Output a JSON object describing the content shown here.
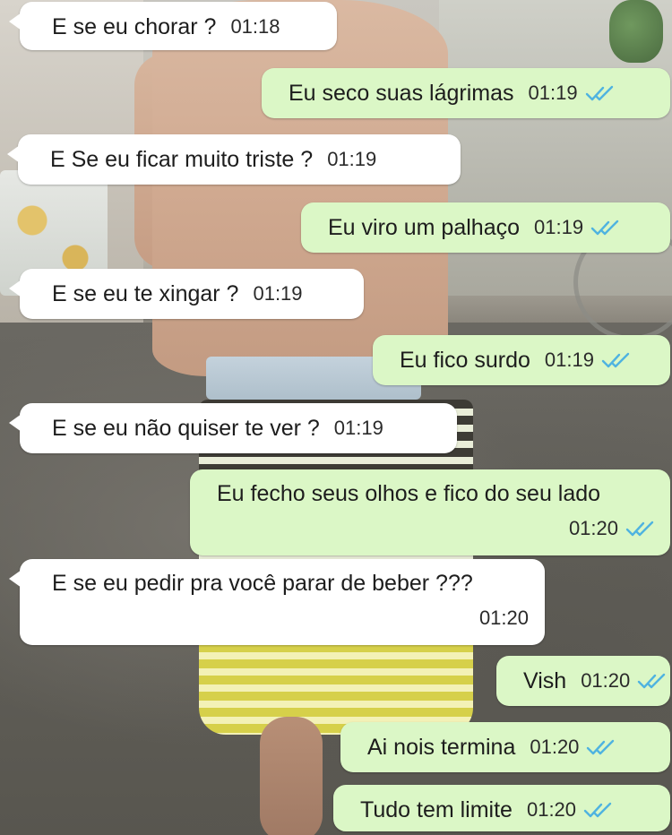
{
  "conversation": {
    "messages": [
      {
        "direction": "in",
        "text": "E se eu chorar ?",
        "time": "01:18"
      },
      {
        "direction": "out",
        "text": "Eu seco suas lágrimas",
        "time": "01:19",
        "status": "read-double-check"
      },
      {
        "direction": "in",
        "text": "E Se eu ficar muito triste ?",
        "time": "01:19"
      },
      {
        "direction": "out",
        "text": "Eu viro um palhaço",
        "time": "01:19",
        "status": "read-double-check"
      },
      {
        "direction": "in",
        "text": "E se eu te xingar ?",
        "time": "01:19"
      },
      {
        "direction": "out",
        "text": "Eu fico surdo",
        "time": "01:19",
        "status": "read-double-check"
      },
      {
        "direction": "in",
        "text": "E se eu não quiser te ver ?",
        "time": "01:19"
      },
      {
        "direction": "out",
        "text": "Eu fecho seus olhos e fico do seu lado",
        "time": "01:20",
        "status": "read-double-check"
      },
      {
        "direction": "in",
        "text": "E se eu pedir pra você parar de beber ???",
        "time": "01:20"
      },
      {
        "direction": "out",
        "text": "Vish",
        "time": "01:20",
        "status": "read-double-check"
      },
      {
        "direction": "out",
        "text": "Ai nois termina",
        "time": "01:20",
        "status": "read-double-check"
      },
      {
        "direction": "out",
        "text": "Tudo tem limite",
        "time": "01:20",
        "status": "read-double-check"
      }
    ]
  },
  "colors": {
    "incoming_bubble": "#ffffff",
    "outgoing_bubble": "#dbf7c6",
    "tick_color": "#4fb3e0",
    "text": "#1d1d1d"
  },
  "icons": {
    "tick": "double-check-icon"
  }
}
